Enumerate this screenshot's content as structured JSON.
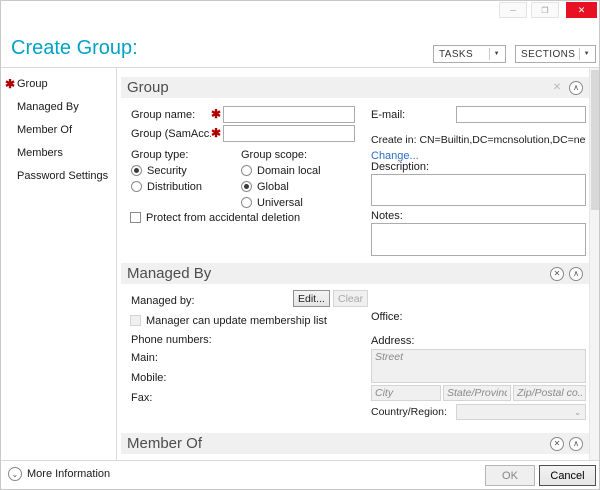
{
  "window": {
    "icons": {
      "minimize": "─",
      "maximize": "❐",
      "close": "✕"
    }
  },
  "header": {
    "title": "Create Group:",
    "tasks_label": "TASKS",
    "sections_label": "SECTIONS",
    "dropdown_arrow": "▼"
  },
  "icons": {
    "collapse": "∧",
    "remove": "✕",
    "more_info_chevron": "⌄",
    "select_arrow": "⌄",
    "required_marker": "✱"
  },
  "sidebar": {
    "items": [
      {
        "label": "Group",
        "required": true
      },
      {
        "label": "Managed By",
        "required": false
      },
      {
        "label": "Member Of",
        "required": false
      },
      {
        "label": "Members",
        "required": false
      },
      {
        "label": "Password Settings",
        "required": false
      }
    ]
  },
  "group_section": {
    "title": "Group",
    "group_name_label": "Group name:",
    "sam_label": "Group (SamAcc...",
    "email_label": "E-mail:",
    "create_in_text": "Create in:  CN=Builtin,DC=mcnsolution,DC=net",
    "change_link": "Change...",
    "group_type_label": "Group type:",
    "group_scope_label": "Group scope:",
    "radio_security": "Security",
    "radio_distribution": "Distribution",
    "radio_domain_local": "Domain local",
    "radio_global": "Global",
    "radio_universal": "Universal",
    "protect_checkbox_label": "Protect from accidental deletion",
    "description_label": "Description:",
    "notes_label": "Notes:"
  },
  "managed_by_section": {
    "title": "Managed By",
    "managed_by_label": "Managed by:",
    "edit_button": "Edit...",
    "clear_button": "Clear",
    "manager_checkbox_label": "Manager can update membership list",
    "phone_numbers_label": "Phone numbers:",
    "main_label": "Main:",
    "mobile_label": "Mobile:",
    "fax_label": "Fax:",
    "office_label": "Office:",
    "address_label": "Address:",
    "street_placeholder": "Street",
    "city_placeholder": "City",
    "state_placeholder": "State/Province",
    "zip_placeholder": "Zip/Postal co...",
    "country_label": "Country/Region:"
  },
  "member_of_section": {
    "title": "Member Of"
  },
  "footer": {
    "more_info": "More Information",
    "ok_label": "OK",
    "cancel_label": "Cancel"
  },
  "colors": {
    "title_accent": "#00a3c6",
    "required_red": "#b00000",
    "close_button_red": "#e81123",
    "link_blue": "#2e6fc0",
    "section_header_bg": "#f0f0f0"
  }
}
